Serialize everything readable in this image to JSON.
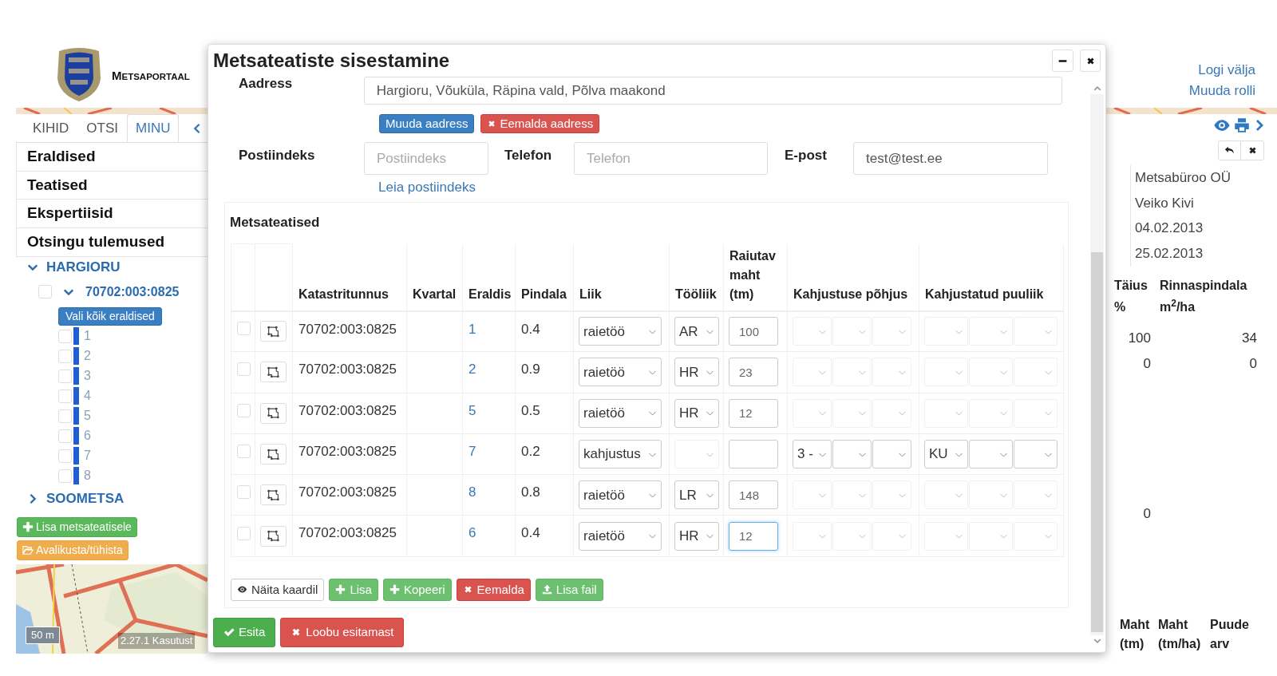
{
  "header": {
    "brand": "METSAPORTAAL",
    "user_links": [
      "Logi välja",
      "Muuda rolli"
    ]
  },
  "sidebar": {
    "tabs": [
      {
        "label": "KIHID",
        "selected": false
      },
      {
        "label": "OTSI",
        "selected": false
      },
      {
        "label": "MINU",
        "selected": true
      }
    ],
    "sections": [
      "Eraldised",
      "Teatised",
      "Ekspertiisid",
      "Otsingu tulemused"
    ],
    "tree": [
      {
        "label": "HARGIORU",
        "expanded": true,
        "children": [
          {
            "label": "70702:003:0825",
            "expanded": true,
            "checked": false,
            "select_all": "Vali kõik eraldised",
            "children": [
              {
                "label": "1",
                "checked": false,
                "color": "#1f5fd6"
              },
              {
                "label": "2",
                "checked": false,
                "color": "#1f5fd6"
              },
              {
                "label": "3",
                "checked": false,
                "color": "#1f5fd6"
              },
              {
                "label": "4",
                "checked": false,
                "color": "#1f5fd6"
              },
              {
                "label": "5",
                "checked": false,
                "color": "#1f5fd6"
              },
              {
                "label": "6",
                "checked": false,
                "color": "#1f5fd6"
              },
              {
                "label": "7",
                "checked": false,
                "color": "#1f5fd6"
              },
              {
                "label": "8",
                "checked": false,
                "color": "#1f5fd6"
              }
            ]
          }
        ]
      },
      {
        "label": "SOOMETSA",
        "expanded": false
      }
    ],
    "actions": [
      {
        "label": "Lisa metsateatisele",
        "kind": "add"
      },
      {
        "label": "Avalikusta/tühista",
        "kind": "publish"
      }
    ],
    "map": {
      "scale": "50 m",
      "version": "2.27.1 Kasutust"
    }
  },
  "right_panel": {
    "info": [
      "Metsabüroo OÜ",
      "Veiko Kivi",
      "04.02.2013",
      "25.02.2013"
    ],
    "table": {
      "columns": [
        "Täius %",
        "Rinnaspindala m$^{2}$/ha"
      ],
      "rows": [
        {
          "cells": [
            "100",
            "34"
          ]
        },
        {
          "cells": [
            "0",
            "0"
          ]
        },
        {
          "cells": [
            "0"
          ]
        }
      ]
    },
    "bottom_columns": [
      "Maht (tm)",
      "Maht (tm/ha)",
      "Puude arv"
    ]
  },
  "modal": {
    "title": "Metsateatiste sisestamine",
    "address": {
      "label": "Aadress",
      "value": "Hargioru, Võuküla, Räpina vald, Põlva maakond"
    },
    "address_buttons": [
      {
        "label": "Muuda aadress",
        "kind": "primary"
      },
      {
        "label": "Eemalda aadress",
        "kind": "danger"
      }
    ],
    "fields": [
      {
        "label": "Postiindeks",
        "placeholder": "Postiindeks"
      },
      {
        "label": "Telefon",
        "placeholder": "Telefon"
      },
      {
        "label": "E-post",
        "value": "test@test.ee"
      }
    ],
    "postcode_link": "Leia postiindeks",
    "section_title": "Metsateatised",
    "table": {
      "columns": [
        "Katastritunnus",
        "Kvartal",
        "Eraldis",
        "Pindala",
        "Liik",
        "Tööliik",
        "Raiutav maht (tm)",
        "Kahjustuse põhjus",
        "Kahjustatud puuliik"
      ],
      "rows": [
        {
          "kind": "harvest",
          "checked": false,
          "focused": false,
          "cadastre": "70702:003:0825",
          "eraldis": "1",
          "area": "0.4",
          "type": "raietöö",
          "work": "AR",
          "volume": "100"
        },
        {
          "kind": "harvest",
          "checked": false,
          "focused": false,
          "cadastre": "70702:003:0825",
          "eraldis": "2",
          "area": "0.9",
          "type": "raietöö",
          "work": "HR",
          "volume": "23"
        },
        {
          "kind": "harvest",
          "checked": false,
          "focused": false,
          "cadastre": "70702:003:0825",
          "eraldis": "5",
          "area": "0.5",
          "type": "raietöö",
          "work": "HR",
          "volume": "12"
        },
        {
          "kind": "damage",
          "checked": false,
          "focused": false,
          "cadastre": "70702:003:0825",
          "eraldis": "7",
          "area": "0.2",
          "type": "kahjustus",
          "cause": "3 -",
          "species": "KU"
        },
        {
          "kind": "harvest",
          "checked": false,
          "focused": false,
          "cadastre": "70702:003:0825",
          "eraldis": "8",
          "area": "0.8",
          "type": "raietöö",
          "work": "LR",
          "volume": "148"
        },
        {
          "kind": "harvest",
          "checked": false,
          "focused": true,
          "cadastre": "70702:003:0825",
          "eraldis": "6",
          "area": "0.4",
          "type": "raietöö",
          "work": "HR",
          "volume": "12"
        }
      ]
    },
    "table_buttons": [
      {
        "label": "Näita kaardil",
        "kind": "default"
      },
      {
        "label": "Lisa",
        "kind": "success"
      },
      {
        "label": "Kopeeri",
        "kind": "success"
      },
      {
        "label": "Eemalda",
        "kind": "danger"
      },
      {
        "label": "Lisa fail",
        "kind": "success"
      }
    ],
    "footer_buttons": [
      {
        "label": "Esita",
        "kind": "success-dark"
      },
      {
        "label": "Loobu esitamast",
        "kind": "danger"
      }
    ]
  }
}
